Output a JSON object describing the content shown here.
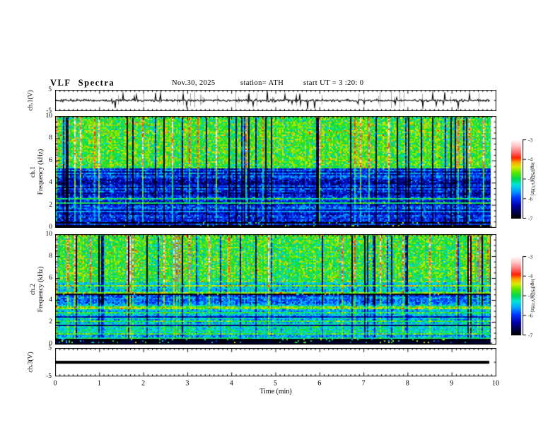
{
  "title": {
    "main": "VLF Spectra",
    "date": "Nov.30, 2025",
    "station": "station= ATH",
    "start_ut": "start UT =  3 :20: 0"
  },
  "xaxis": {
    "label": "Time (min)",
    "tick_labels": [
      "0",
      "1",
      "2",
      "3",
      "4",
      "5",
      "6",
      "7",
      "8",
      "9",
      "10"
    ]
  },
  "panels": {
    "ch1_wave": {
      "ylabel": "ch.1(V)",
      "ytick_top": "5",
      "ytick_bottom": "-5"
    },
    "ch1_spec": {
      "ylabel_channel": "ch.1",
      "ylabel_axis": "Frequency (kHz)",
      "ytick_labels": [
        "10",
        "8",
        "6",
        "4",
        "2",
        "0"
      ]
    },
    "ch2_spec": {
      "ylabel_channel": "ch.2",
      "ylabel_axis": "Frequency (kHz)",
      "ytick_labels": [
        "10",
        "8",
        "6",
        "4",
        "2",
        "0"
      ]
    },
    "ch3_wave": {
      "ylabel": "ch.3(V)",
      "ytick_top": "5",
      "ytick_bottom": "-5"
    }
  },
  "colorbar": {
    "tick_labels": [
      "-3",
      "-4",
      "-5",
      "-6",
      "-7"
    ],
    "label": "log(PSD)(V²/Hz)"
  },
  "chart_data": {
    "type": "heatmap",
    "subtype": "multi-panel VLF spectrogram display",
    "time": {
      "label": "Time (min)",
      "range": [
        0,
        10
      ],
      "data_end_min": 9.85,
      "major_tick_step": 1,
      "minor_tick_step": 0.1
    },
    "colormap": {
      "range": [
        -7,
        -3
      ],
      "stops": [
        {
          "t": 0.0,
          "c": "#000000"
        },
        {
          "t": 0.06,
          "c": "#000038"
        },
        {
          "t": 0.16,
          "c": "#0000a8"
        },
        {
          "t": 0.26,
          "c": "#0038ff"
        },
        {
          "t": 0.35,
          "c": "#00a4ff"
        },
        {
          "t": 0.43,
          "c": "#00e4d8"
        },
        {
          "t": 0.5,
          "c": "#00d850"
        },
        {
          "t": 0.58,
          "c": "#58e800"
        },
        {
          "t": 0.65,
          "c": "#d8ec00"
        },
        {
          "t": 0.71,
          "c": "#ffa800"
        },
        {
          "t": 0.77,
          "c": "#ff2000"
        },
        {
          "t": 0.84,
          "c": "#ff7070"
        },
        {
          "t": 0.92,
          "c": "#ffc4c4"
        },
        {
          "t": 1.0,
          "c": "#ffffff"
        }
      ]
    },
    "colorbars": [
      {
        "for": "ch1_spec",
        "ticks": [
          -3,
          -4,
          -5,
          -6,
          -7
        ],
        "label": "log(PSD)(V²/Hz)"
      },
      {
        "for": "ch2_spec",
        "ticks": [
          -3,
          -4,
          -5,
          -6,
          -7
        ],
        "label": "log(PSD)(V²/Hz)"
      }
    ],
    "panels": [
      {
        "id": "ch1_wave",
        "kind": "waveform",
        "units": "V",
        "yrange": [
          -5,
          5
        ],
        "description": "broadband noise around 0 V with impulsive spikes toward ±5 V",
        "seed": 303,
        "noise_sd_v": 0.55,
        "spike_prob": 0.045,
        "gray_spike_prob": 0.1
      },
      {
        "id": "ch1_spec",
        "kind": "spectrogram",
        "yrange_khz": [
          0,
          10
        ],
        "seed": 101,
        "streaks": {
          "neg_prob": 0.1,
          "pos_prob": 0.07
        },
        "bands": [
          {
            "f": [
              5.3,
              10
            ],
            "base": -4.8,
            "noise": 0.55,
            "streak": 1.0,
            "rowVar": 0.12
          },
          {
            "f": [
              2.55,
              5.3
            ],
            "base": -6.1,
            "noise": 0.5,
            "streak": 0.9,
            "rowVar": 0.42
          },
          {
            "f": [
              0.5,
              2.55
            ],
            "base": -6.0,
            "noise": 0.5,
            "streak": 0.5,
            "rowVar": 0.5
          },
          {
            "f": [
              0,
              0.5
            ],
            "base": -6.9,
            "noise": 0.2,
            "streak": 0.1,
            "rowVar": 0.25,
            "speckle": 0.07
          }
        ],
        "lines": [
          {
            "f": 9.93,
            "hw": 0.1,
            "v": -4.6,
            "noise": 0.75
          },
          {
            "f": 5.2,
            "hw": 0.05,
            "v": -6.4,
            "noise": 0.35
          },
          {
            "f": 2.6,
            "hw": 0.05,
            "v": -5.0,
            "noise": 0.4
          },
          {
            "f": 2.2,
            "hw": 0.05,
            "v": -4.95,
            "noise": 0.45
          },
          {
            "f": 1.45,
            "hw": 0.12,
            "v": -5.6,
            "noise": 0.3
          },
          {
            "f": 1.0,
            "hw": 0.05,
            "v": -5.35,
            "noise": 0.4
          },
          {
            "f": 0.75,
            "hw": 0.04,
            "v": -6.5,
            "noise": 0.3
          },
          {
            "f": 0.28,
            "hw": 0.05,
            "v": -6.0,
            "noise": 0.5
          },
          {
            "f": 0.08,
            "hw": 0.08,
            "v": -6.95,
            "noise": 0.1
          }
        ]
      },
      {
        "id": "ch2_spec",
        "kind": "spectrogram",
        "yrange_khz": [
          0,
          10
        ],
        "seed": 202,
        "streaks": {
          "neg_prob": 0.1,
          "pos_prob": 0.07
        },
        "bands": [
          {
            "f": [
              5.6,
              10
            ],
            "base": -4.85,
            "noise": 0.55,
            "streak": 1.0,
            "rowVar": 0.12
          },
          {
            "f": [
              4.8,
              5.6
            ],
            "base": -5.25,
            "noise": 0.5,
            "streak": 0.7,
            "rowVar": 0.25
          },
          {
            "f": [
              3.6,
              4.55
            ],
            "base": -5.8,
            "noise": 0.5,
            "streak": 0.8,
            "rowVar": 0.35
          },
          {
            "f": [
              0.5,
              3.6
            ],
            "base": -5.35,
            "noise": 0.45,
            "streak": 0.4,
            "rowVar": 0.3
          },
          {
            "f": [
              0,
              0.5
            ],
            "base": -6.9,
            "noise": 0.2,
            "streak": 0.1,
            "rowVar": 0.25,
            "speckle": 0.07
          }
        ],
        "lines": [
          {
            "f": 9.93,
            "hw": 0.1,
            "v": -4.6,
            "noise": 0.75
          },
          {
            "f": 5.35,
            "hw": 0.07,
            "v": -4.55,
            "noise": 0.55
          },
          {
            "f": 4.65,
            "hw": 0.07,
            "v": -4.55,
            "noise": 0.55
          },
          {
            "f": 3.3,
            "hw": 0.14,
            "v": -4.6,
            "noise": 0.5
          },
          {
            "f": 2.85,
            "hw": 0.05,
            "v": -4.95,
            "noise": 0.45
          },
          {
            "f": 2.5,
            "hw": 0.05,
            "v": -6.3,
            "noise": 0.35
          },
          {
            "f": 2.15,
            "hw": 0.05,
            "v": -4.85,
            "noise": 0.45
          },
          {
            "f": 1.75,
            "hw": 0.05,
            "v": -6.5,
            "noise": 0.3
          },
          {
            "f": 1.0,
            "hw": 0.07,
            "v": -4.8,
            "noise": 0.5
          },
          {
            "f": 0.6,
            "hw": 0.04,
            "v": -5.1,
            "noise": 0.4
          },
          {
            "f": 0.08,
            "hw": 0.08,
            "v": -6.95,
            "noise": 0.1
          }
        ]
      },
      {
        "id": "ch3_wave",
        "kind": "flatline",
        "units": "V",
        "yrange": [
          -5,
          5
        ],
        "value_v": 0,
        "line_thickness_v": 0.65,
        "description": "constant 0 V thick trace for full record length"
      }
    ]
  }
}
